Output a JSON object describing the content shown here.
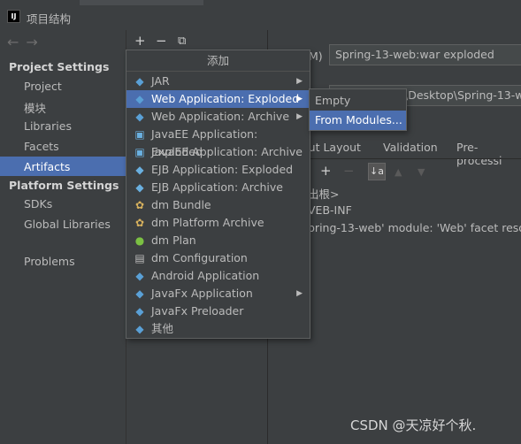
{
  "window": {
    "title": "项目结构",
    "app_icon": "IJ"
  },
  "nav": {
    "back_icon": "←",
    "forward_icon": "→"
  },
  "sidebar": {
    "project_settings_header": "Project Settings",
    "platform_settings_header": "Platform Settings",
    "items_project": [
      "Project",
      "模块",
      "Libraries",
      "Facets",
      "Artifacts"
    ],
    "items_platform": [
      "SDKs",
      "Global Libraries"
    ],
    "problems": "Problems",
    "selected": "Artifacts"
  },
  "toolbar": {
    "add": "+",
    "remove": "−",
    "copy": "⧉"
  },
  "artifact": {
    "name_label_partial": "M)",
    "name_value": "Spring-13-web:war exploded",
    "output_path_partial": "\\Desktop\\Spring-13-w"
  },
  "tabs": [
    "Output Layout",
    "Validation",
    "Pre-processi"
  ],
  "tabs_visible": [
    "out Layout",
    "Validation",
    "Pre-processi"
  ],
  "layout_toolbar": {
    "add": "+",
    "remove": "−",
    "sort": "↓a",
    "up": "▲",
    "down": "▼"
  },
  "tree": {
    "root": "出根>",
    "webinf": "VEB-INF",
    "module_line": "pring-13-web' module: 'Web' facet resou"
  },
  "popup": {
    "header": "添加",
    "items": [
      {
        "label": "JAR",
        "icon": "jar-icon",
        "glyph": "◆",
        "has_sub": true
      },
      {
        "label": "Web Application: Exploded",
        "icon": "web-app-icon",
        "glyph": "◆",
        "has_sub": true
      },
      {
        "label": "Web Application: Archive",
        "icon": "web-app-icon",
        "glyph": "◆",
        "has_sub": true
      },
      {
        "label": "JavaEE Application: Exploded",
        "icon": "javaee-icon",
        "glyph": "▣",
        "has_sub": false
      },
      {
        "label": "JavaEE Application: Archive",
        "icon": "javaee-icon",
        "glyph": "▣",
        "has_sub": false
      },
      {
        "label": "EJB Application: Exploded",
        "icon": "ejb-icon",
        "glyph": "◆",
        "has_sub": false
      },
      {
        "label": "EJB Application: Archive",
        "icon": "ejb-icon",
        "glyph": "◆",
        "has_sub": false
      },
      {
        "label": "dm Bundle",
        "icon": "dm-bundle-icon",
        "glyph": "✿",
        "has_sub": false
      },
      {
        "label": "dm Platform Archive",
        "icon": "dm-platform-icon",
        "glyph": "✿",
        "has_sub": false
      },
      {
        "label": "dm Plan",
        "icon": "dm-plan-icon",
        "glyph": "●",
        "has_sub": false
      },
      {
        "label": "dm Configuration",
        "icon": "dm-config-icon",
        "glyph": "▤",
        "has_sub": false
      },
      {
        "label": "Android Application",
        "icon": "android-icon",
        "glyph": "◆",
        "has_sub": false
      },
      {
        "label": "JavaFx Application",
        "icon": "javafx-icon",
        "glyph": "◆",
        "has_sub": true
      },
      {
        "label": "JavaFx Preloader",
        "icon": "javafx-icon",
        "glyph": "◆",
        "has_sub": false
      },
      {
        "label": "其他",
        "icon": "other-icon",
        "glyph": "◆",
        "has_sub": false
      }
    ],
    "selected_index": 1
  },
  "submenu": {
    "items": [
      "Empty",
      "From Modules..."
    ],
    "selected": "From Modules..."
  },
  "watermark": "CSDN @天凉好个秋.",
  "colors": {
    "selection": "#4b6eaf",
    "background": "#3c3f41",
    "text": "#bbbbbb"
  }
}
